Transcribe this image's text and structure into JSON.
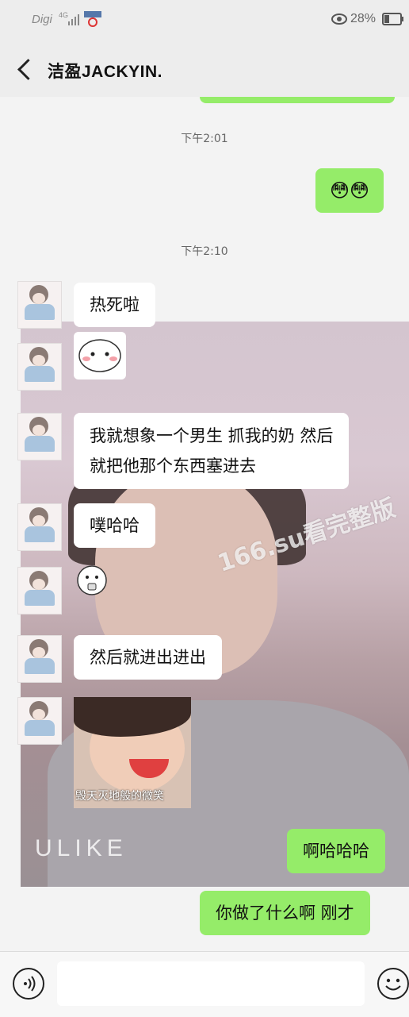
{
  "status_bar": {
    "carrier": "Digi",
    "network": "4G",
    "battery_text": "28%"
  },
  "header": {
    "title": "洁盈JACKYIN."
  },
  "messages": {
    "time1": "下午2:01",
    "emoji_sent": "😳😳",
    "time2": "下午2:10",
    "m1": "热死啦",
    "m3_line1": "我就想象一个男生 抓我的奶 然后",
    "m3_line2": "就把他那个东西塞进去",
    "m4": "噗哈哈",
    "m6": "然后就进出进出",
    "photo_caption": "毁天灭地般的微笑",
    "r1": "啊哈哈哈",
    "r2": "你做了什么啊 刚才"
  },
  "background": {
    "overlay_text": "ULIKE",
    "watermark": "166.su看完整版"
  },
  "colors": {
    "sent_bubble": "#95ec69",
    "received_bubble": "#ffffff"
  }
}
